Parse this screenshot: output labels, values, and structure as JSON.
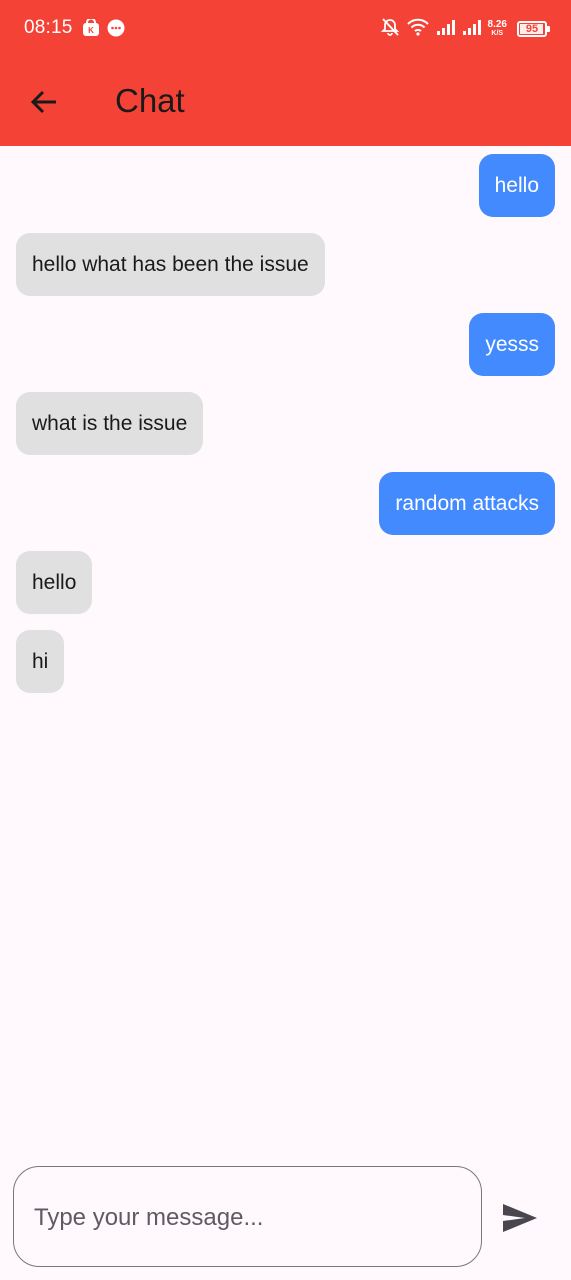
{
  "status_bar": {
    "time": "08:15",
    "net_speed": "8.26",
    "net_unit": "K/S",
    "battery": "95",
    "battery_level": 0.95,
    "icons": [
      "shopping-bag-icon",
      "chat-bubble-icon",
      "muted-bell-icon",
      "wifi-icon",
      "signal-icon",
      "signal-icon",
      "battery-icon"
    ]
  },
  "app_bar": {
    "title": "Chat",
    "back_icon": "arrow-left-icon"
  },
  "messages": [
    {
      "text": "hello",
      "sender": "me"
    },
    {
      "text": "hello what has been the issue",
      "sender": "other"
    },
    {
      "text": "yesss",
      "sender": "me"
    },
    {
      "text": "what is the issue",
      "sender": "other"
    },
    {
      "text": "random attacks",
      "sender": "me"
    },
    {
      "text": "hello",
      "sender": "other"
    },
    {
      "text": "hi",
      "sender": "other"
    }
  ],
  "composer": {
    "value": "",
    "placeholder": "Type your message...",
    "send_icon": "send-icon"
  },
  "colors": {
    "app_bar": "#F44336",
    "sent_bubble": "#448AFF",
    "received_bubble": "#E0E0E0",
    "background": "#FFF8FD"
  }
}
